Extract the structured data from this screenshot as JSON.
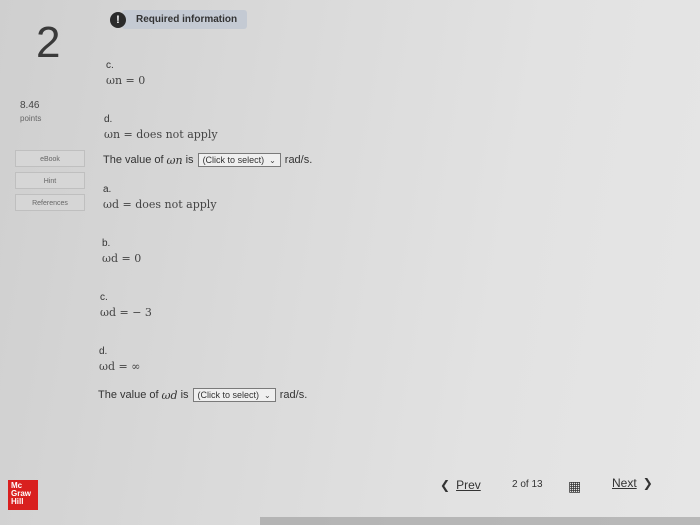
{
  "question": {
    "number": "2",
    "required_label": "Required information",
    "alert_symbol": "!",
    "points_value": "8.46",
    "points_label": "points"
  },
  "sidebar": {
    "ebook": "eBook",
    "hint": "Hint",
    "references": "References"
  },
  "wn": {
    "options": [
      {
        "letter": "c.",
        "expr": "ωn = 0"
      },
      {
        "letter": "d.",
        "expr": "ωn = does not apply"
      }
    ],
    "sentence_prefix": "The value of",
    "symbol": "ωn",
    "sentence_is": "is",
    "select": "(Click to select)",
    "unit": "rad/s."
  },
  "wd": {
    "options": [
      {
        "letter": "a.",
        "expr": "ωd = does not apply"
      },
      {
        "letter": "b.",
        "expr": "ωd = 0"
      },
      {
        "letter": "c.",
        "expr": "ωd = − 3"
      },
      {
        "letter": "d.",
        "expr": "ωd = ∞"
      }
    ],
    "sentence_prefix": "The value of",
    "symbol": "ωd",
    "sentence_is": "is",
    "select": "(Click to select)",
    "unit": "rad/s."
  },
  "footer": {
    "logo_lines": [
      "Mc",
      "Graw",
      "Hill"
    ],
    "prev_label": "Prev",
    "page_indicator": "2 of 13",
    "next_label": "Next"
  }
}
